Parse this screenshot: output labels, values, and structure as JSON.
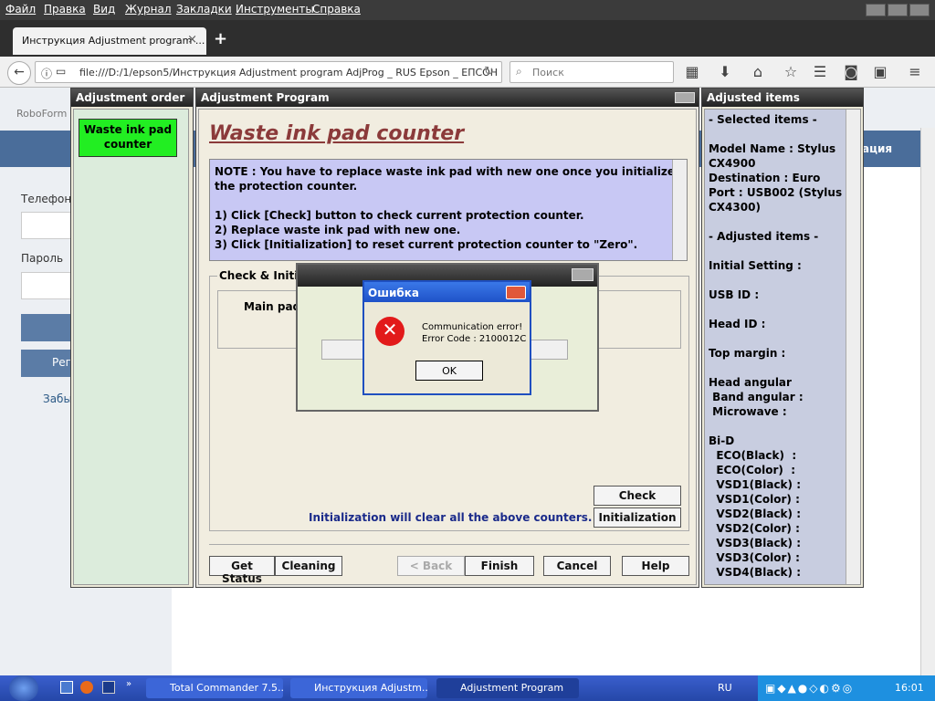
{
  "menu": [
    "Файл",
    "Правка",
    "Вид",
    "Журнал",
    "Закладки",
    "Инструменты",
    "Справка"
  ],
  "tab": {
    "title": "Инструкция Adjustment program ...",
    "close": "×",
    "new": "+"
  },
  "nav": {
    "url": "file:///D:/1/epson5/Инструкция Adjustment program AdjProg _ RUS Epson _ EПСОН",
    "search_placeholder": "Поиск"
  },
  "page": {
    "roboform": "RoboForm",
    "phone": "Телефон",
    "password": "Пароль",
    "register_partial": "Рег",
    "forgot_partial": "Забы",
    "right_partial": "ация"
  },
  "adj": {
    "order_title": "Adjustment order",
    "order_item": "Waste ink pad counter",
    "main_title": "Adjustment Program",
    "heading": "Waste ink pad counter",
    "note": [
      "NOTE : You have to replace waste ink pad with new one once you initialize",
      "the protection counter.",
      "",
      "1) Click [Check] button to check current protection counter.",
      "2) Replace waste ink pad with new one.",
      "3) Click [Initialization] to reset current protection counter to \"Zero\"."
    ],
    "group_title": "Check & Initia",
    "main_pad": "Main pad",
    "init_note": "Initialization will clear all the above counters.",
    "buttons": {
      "check": "Check",
      "init": "Initialization",
      "get_status": "Get Status",
      "cleaning": "Cleaning",
      "back": "< Back",
      "finish": "Finish",
      "cancel": "Cancel",
      "help": "Help"
    },
    "items_title": "Adjusted items",
    "items": [
      "- Selected items -",
      "",
      "Model Name : Stylus",
      "CX4900",
      "Destination : Euro",
      "Port : USB002 (Stylus",
      "CX4300)",
      "",
      "- Adjusted items -",
      "",
      "Initial Setting :",
      "",
      "USB ID :",
      "",
      "Head ID :",
      "",
      "Top margin :",
      "",
      "Head angular",
      " Band angular :",
      " Microwave :",
      "",
      "Bi-D",
      "  ECO(Black)  :",
      "  ECO(Color)  :",
      "  VSD1(Black) :",
      "  VSD1(Color) :",
      "  VSD2(Black) :",
      "  VSD2(Color) :",
      "  VSD3(Black) :",
      "  VSD3(Color) :",
      "  VSD4(Black) :"
    ]
  },
  "dialog": {
    "title": "Ошибка",
    "line1": "Communication error!",
    "line2": "Error Code : 2100012C",
    "ok": "OK"
  },
  "taskbar": {
    "t1": "Total Commander 7.5...",
    "t2": "Инструкция Adjustm...",
    "t3": "Adjustment Program",
    "lang": "RU",
    "time": "16:01"
  }
}
